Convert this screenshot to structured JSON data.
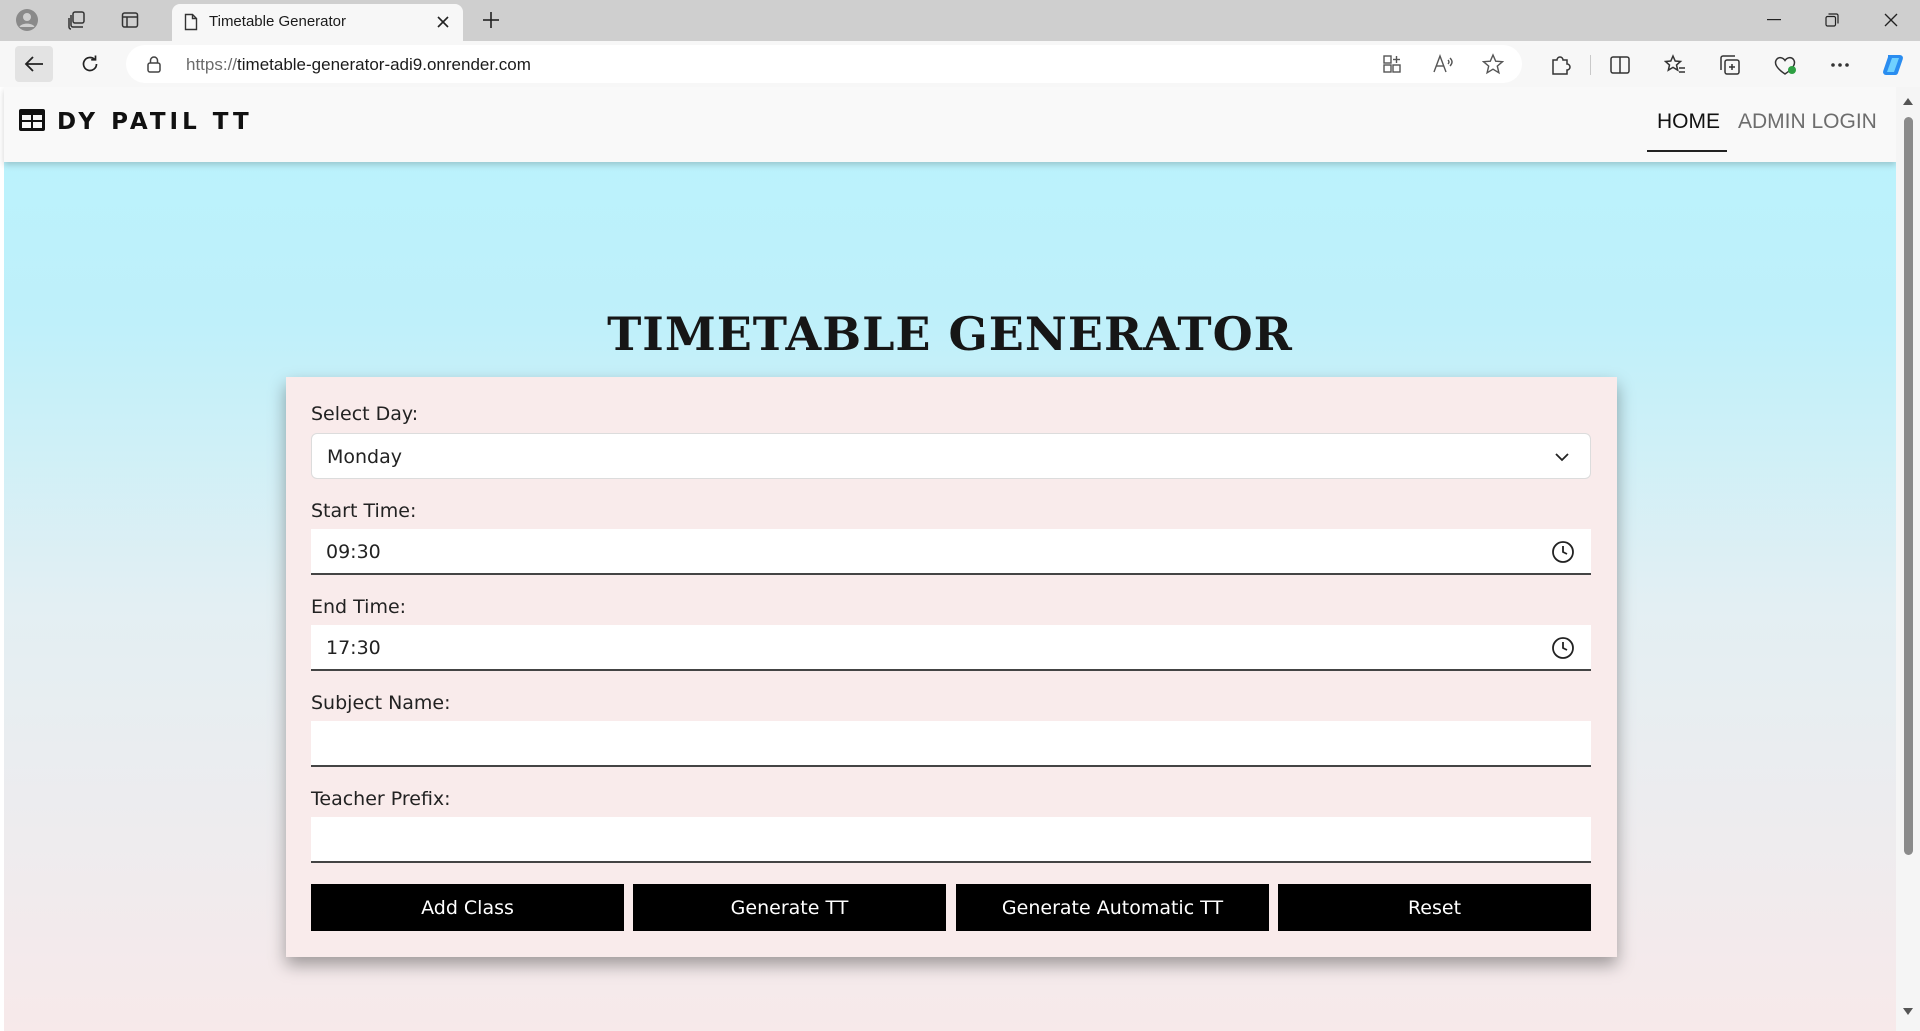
{
  "browser": {
    "tab_title": "Timetable Generator",
    "url_protocol": "https://",
    "url_host": "timetable-generator-adi9.onrender.com"
  },
  "navbar": {
    "brand": "DY PATIL TT",
    "links": [
      {
        "label": "HOME",
        "active": true
      },
      {
        "label": "ADMIN LOGIN",
        "active": false
      }
    ]
  },
  "hero": {
    "title": "TIMETABLE GENERATOR"
  },
  "form": {
    "day": {
      "label": "Select Day:",
      "value": "Monday"
    },
    "start_time": {
      "label": "Start Time:",
      "value": "09:30"
    },
    "end_time": {
      "label": "End Time:",
      "value": "17:30"
    },
    "subject_name": {
      "label": "Subject Name:",
      "value": ""
    },
    "teacher_prefix": {
      "label": "Teacher Prefix:",
      "value": ""
    },
    "buttons": {
      "add_class": "Add Class",
      "generate_tt": "Generate TT",
      "generate_automatic_tt": "Generate Automatic TT",
      "reset": "Reset"
    }
  },
  "colors": {
    "button_bg": "#000000",
    "card_bg": "#f9ebeb",
    "gradient_top": "#b9f3fd",
    "gradient_bottom": "#f7e9ea"
  }
}
